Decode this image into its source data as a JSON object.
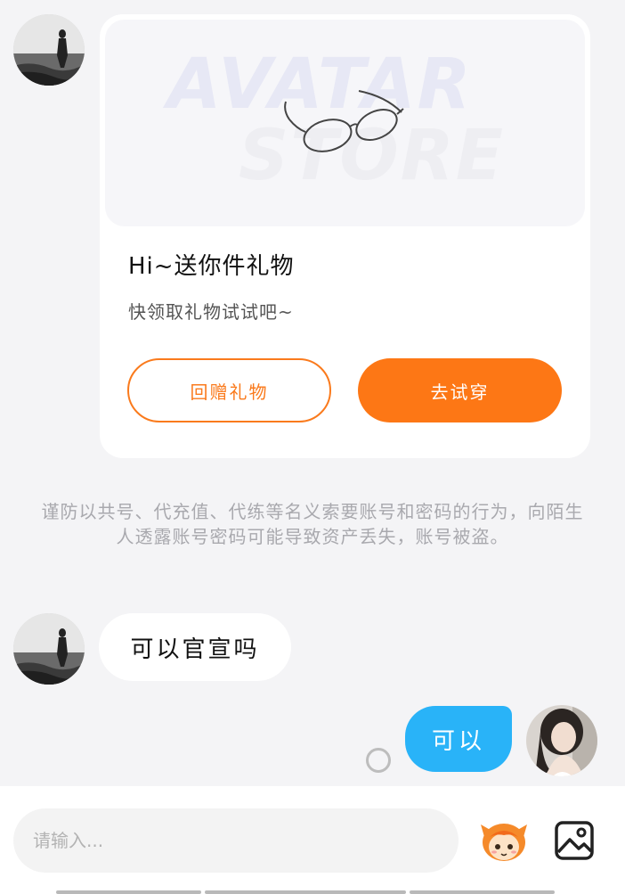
{
  "gift_card": {
    "banner_line1": "AVATAR",
    "banner_line2": "STORE",
    "title": "Hi~送你件礼物",
    "subtitle": "快领取礼物试试吧~",
    "return_gift_label": "回赠礼物",
    "try_on_label": "去试穿"
  },
  "warning_text": "谨防以共号、代充值、代练等名义索要账号和密码的行为，向陌生人透露账号密码可能导致资产丢失，账号被盗。",
  "messages": [
    {
      "direction": "incoming",
      "text": "可以官宣吗"
    },
    {
      "direction": "outgoing",
      "text": "可以"
    }
  ],
  "composer": {
    "placeholder": "请输入...",
    "mascot_icon": "mascot-emoji-icon",
    "image_icon": "image-icon"
  },
  "colors": {
    "accent_orange": "#fd7715",
    "outgoing_bubble": "#29b3f8",
    "background": "#f4f4f6"
  }
}
